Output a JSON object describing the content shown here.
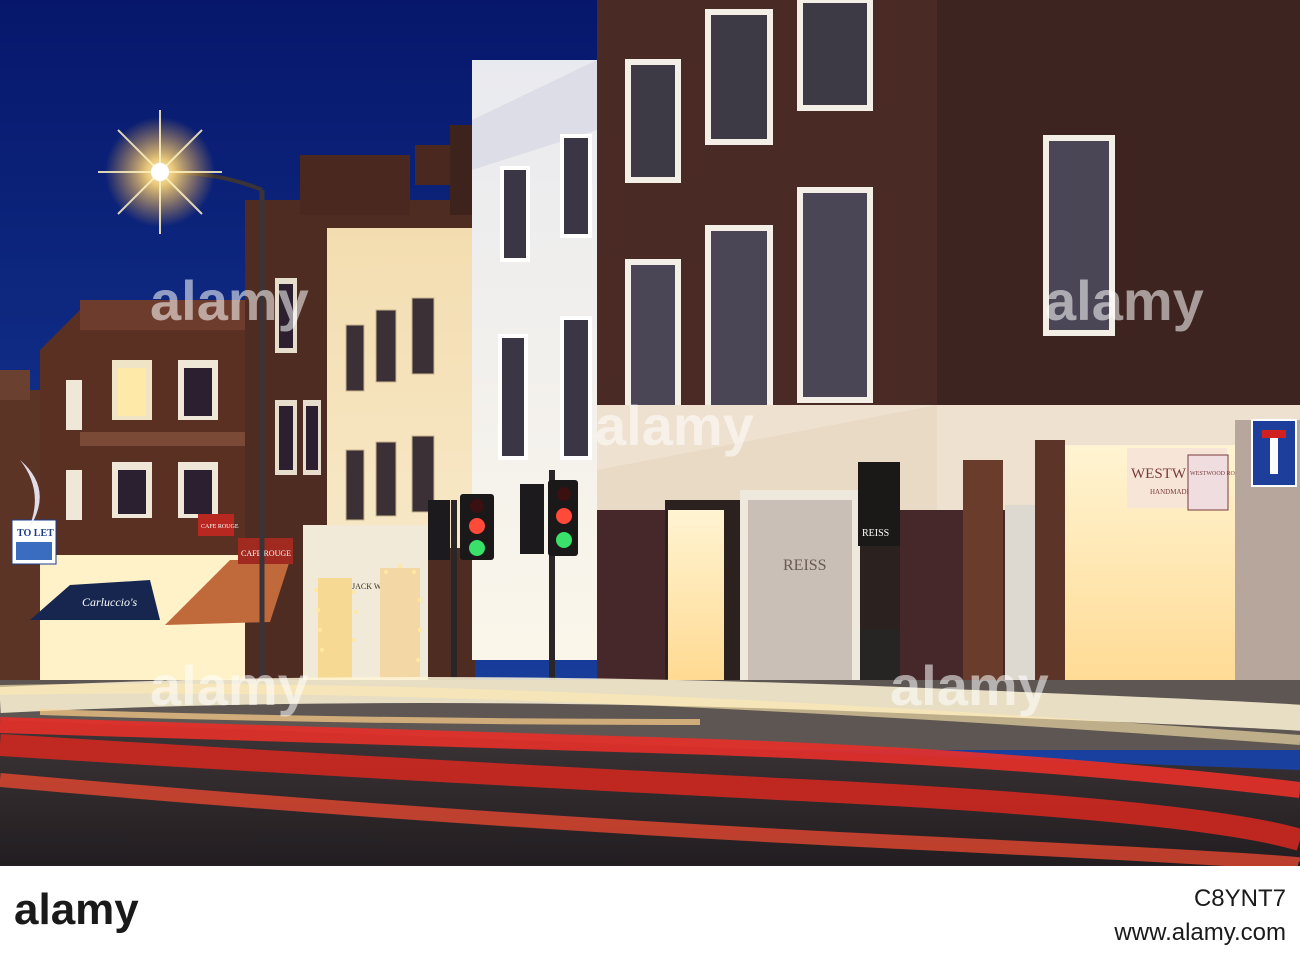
{
  "photo": {
    "signs": {
      "to_let": "TO LET",
      "cafe_rouge_small": "CAFE ROUGE",
      "cafe_rouge_awning": "CAFE ROUGE",
      "carluccios": "Carluccio's",
      "jack_wills": "JACK WILLS",
      "reiss_window": "REISS",
      "reiss_sign": "REISS",
      "westwood": "WESTW",
      "westwood_sub": "HANDMADE",
      "westwood_hanging": "WESTWOOD ROCKS"
    },
    "watermark": "alamy",
    "colors": {
      "sky": "#0d2a7a",
      "brick": "#4a2a22",
      "light_trail_red": "#e8302a",
      "light_trail_white": "#fff6d8",
      "shop_glow": "#ffe7a8"
    }
  },
  "footer": {
    "brand": "alamy",
    "stock_code": "C8YNT7",
    "site": "www.alamy.com"
  }
}
